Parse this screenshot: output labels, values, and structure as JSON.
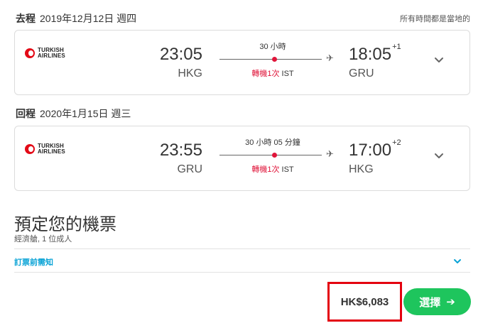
{
  "outbound": {
    "label": "去程",
    "date": "2019年12月12日 週四",
    "airline": {
      "line1": "TURKISH",
      "line2": "AIRLINES"
    },
    "depart_time": "23:05",
    "depart_code": "HKG",
    "duration": "30 小時",
    "stops": "轉機1次",
    "stop_airport": "IST",
    "arrive_time": "18:05",
    "arrive_offset": "+1",
    "arrive_code": "GRU"
  },
  "local_time_note": "所有時間都是當地的",
  "return": {
    "label": "回程",
    "date": "2020年1月15日 週三",
    "airline": {
      "line1": "TURKISH",
      "line2": "AIRLINES"
    },
    "depart_time": "23:55",
    "depart_code": "GRU",
    "duration": "30 小時 05 分鐘",
    "stops": "轉機1次",
    "stop_airport": "IST",
    "arrive_time": "17:00",
    "arrive_offset": "+2",
    "arrive_code": "HKG"
  },
  "booking": {
    "title": "預定您的機票",
    "subtitle": "經濟艙, 1 位成人",
    "notice_link": "訂票前需知",
    "price": "HK$6,083",
    "select_label": "選擇",
    "select_arrow": "➔"
  },
  "colors": {
    "accent_green": "#1ec55d",
    "stop_red": "#e0153a",
    "link_blue": "#0aa3d6",
    "highlight_red": "#e4000f"
  },
  "icons": {
    "plane": "✈"
  }
}
